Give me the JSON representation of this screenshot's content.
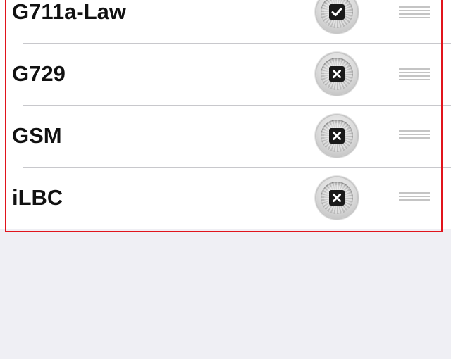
{
  "codecs": [
    {
      "name": "G711a-Law",
      "enabled": true,
      "state_icon": "check-icon"
    },
    {
      "name": "G729",
      "enabled": false,
      "state_icon": "x-icon"
    },
    {
      "name": "GSM",
      "enabled": false,
      "state_icon": "x-icon"
    },
    {
      "name": "iLBC",
      "enabled": false,
      "state_icon": "x-icon"
    }
  ],
  "colors": {
    "highlight_border": "#e1141c",
    "page_background": "#efeff4",
    "list_background": "#ffffff",
    "icon_fill": "#1a1a1a"
  }
}
